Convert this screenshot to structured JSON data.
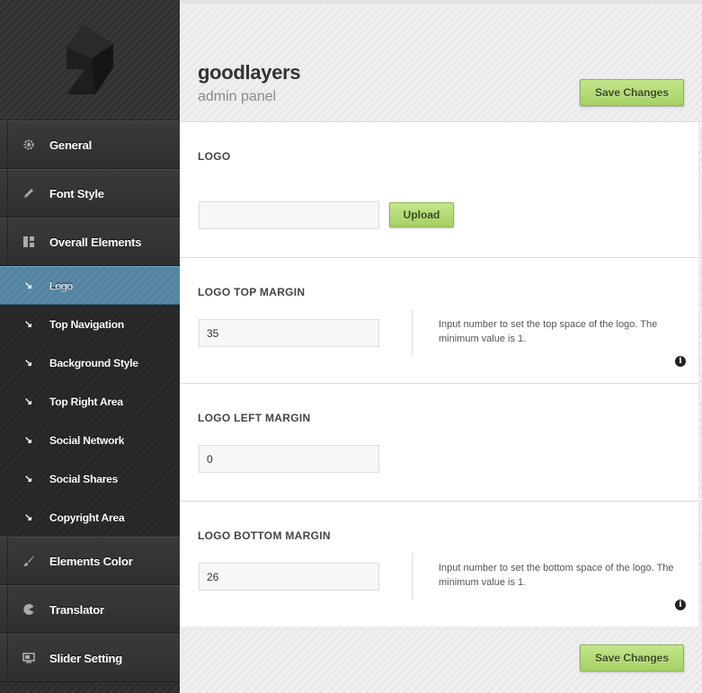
{
  "sidebar": {
    "main_items": [
      {
        "label": "General",
        "icon": "gear-icon"
      },
      {
        "label": "Font Style",
        "icon": "pencil-icon"
      },
      {
        "label": "Overall Elements",
        "icon": "layout-icon"
      },
      {
        "label": "Elements Color",
        "icon": "brush-icon"
      },
      {
        "label": "Translator",
        "icon": "pacman-icon"
      },
      {
        "label": "Slider Setting",
        "icon": "monitor-icon"
      }
    ],
    "sub_items": [
      {
        "label": "Logo",
        "active": true
      },
      {
        "label": "Top Navigation"
      },
      {
        "label": "Background Style"
      },
      {
        "label": "Top Right Area"
      },
      {
        "label": "Social Network"
      },
      {
        "label": "Social Shares"
      },
      {
        "label": "Copyright Area"
      }
    ],
    "arrow": "↘"
  },
  "header": {
    "title": "goodlayers",
    "subtitle": "admin panel",
    "save_label": "Save Changes"
  },
  "sections": {
    "logo": {
      "title": "LOGO",
      "value": "",
      "upload_label": "Upload"
    },
    "top_margin": {
      "title": "LOGO TOP MARGIN",
      "value": "35",
      "description": "Input number to set the top space of the logo. The minimum value is 1."
    },
    "left_margin": {
      "title": "LOGO LEFT MARGIN",
      "value": "0"
    },
    "bottom_margin": {
      "title": "LOGO BOTTOM MARGIN",
      "value": "26",
      "description": "Input number to set the bottom space of the logo. The minimum value is 1."
    }
  },
  "footer": {
    "save_label": "Save Changes"
  },
  "info_glyph": "i",
  "colors": {
    "accent_green": "#a5d163",
    "active_blue": "#5a8aa6",
    "sidebar_dark": "#2f2f2f"
  }
}
